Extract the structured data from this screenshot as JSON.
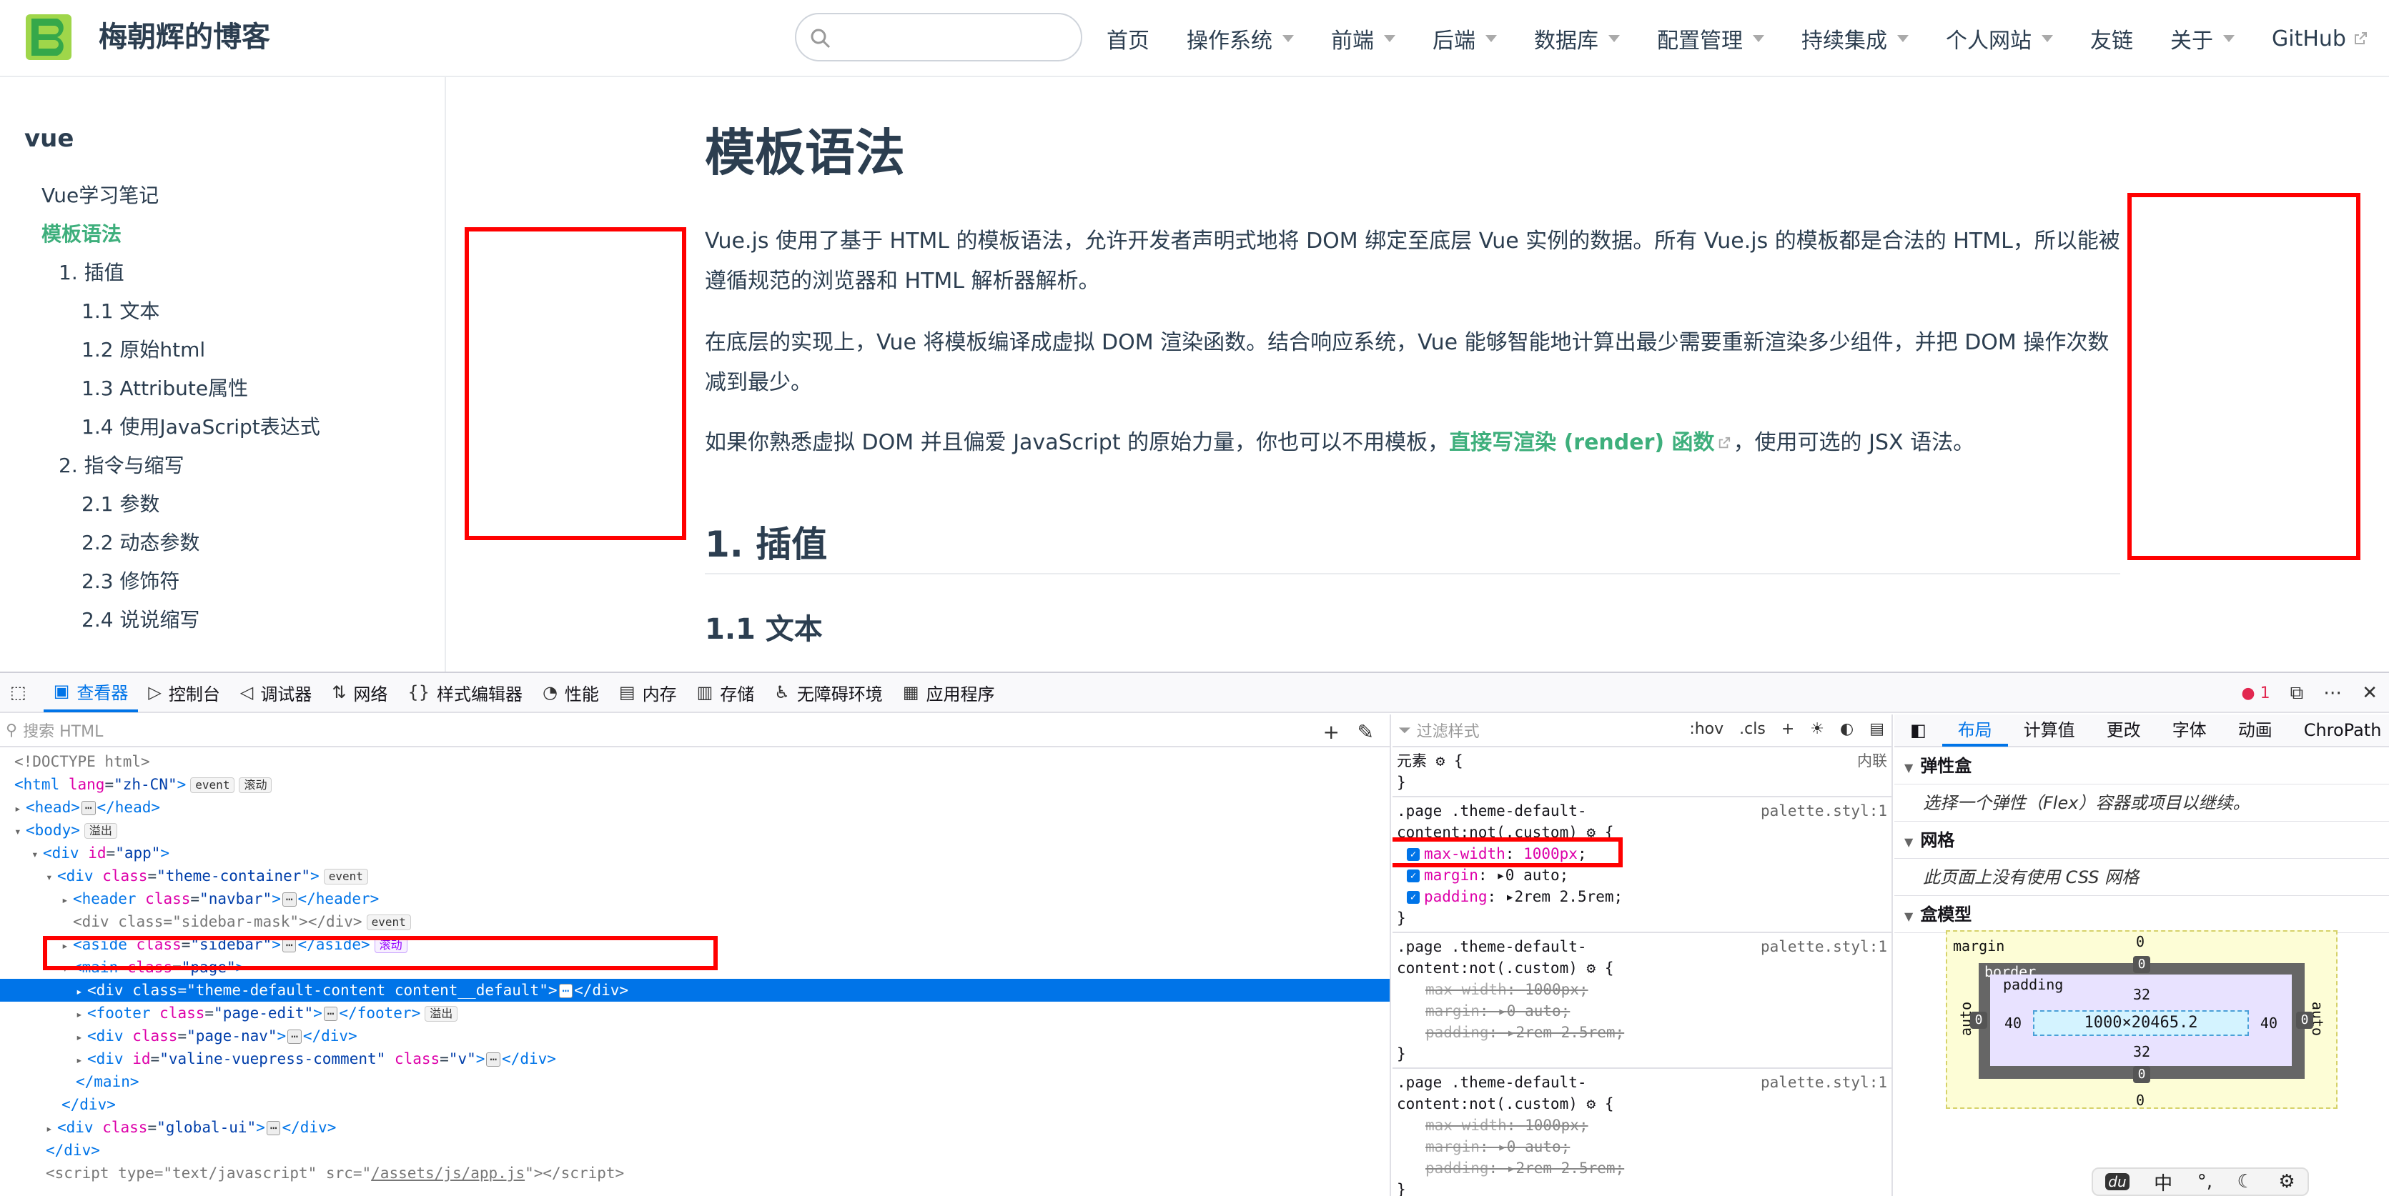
{
  "site": {
    "title": "梅朝辉的博客",
    "search_placeholder": ""
  },
  "nav": [
    {
      "label": "首页",
      "caret": false
    },
    {
      "label": "操作系统",
      "caret": true
    },
    {
      "label": "前端",
      "caret": true
    },
    {
      "label": "后端",
      "caret": true
    },
    {
      "label": "数据库",
      "caret": true
    },
    {
      "label": "配置管理",
      "caret": true
    },
    {
      "label": "持续集成",
      "caret": true
    },
    {
      "label": "个人网站",
      "caret": true
    },
    {
      "label": "友链",
      "caret": false
    },
    {
      "label": "关于",
      "caret": true
    },
    {
      "label": "GitHub",
      "caret": false,
      "external": true
    }
  ],
  "sidebar": {
    "group": "vue",
    "items": [
      {
        "label": "Vue学习笔记",
        "level": 1
      },
      {
        "label": "模板语法",
        "level": 1,
        "active": true
      },
      {
        "label": "1. 插值",
        "level": 2
      },
      {
        "label": "1.1 文本",
        "level": 3
      },
      {
        "label": "1.2 原始html",
        "level": 3
      },
      {
        "label": "1.3 Attribute属性",
        "level": 3
      },
      {
        "label": "1.4 使用JavaScript表达式",
        "level": 3
      },
      {
        "label": "2. 指令与缩写",
        "level": 2
      },
      {
        "label": "2.1 参数",
        "level": 3
      },
      {
        "label": "2.2 动态参数",
        "level": 3
      },
      {
        "label": "2.3 修饰符",
        "level": 3
      },
      {
        "label": "2.4 说说缩写",
        "level": 3
      }
    ]
  },
  "article": {
    "h1": "模板语法",
    "p1": "Vue.js 使用了基于 HTML 的模板语法，允许开发者声明式地将 DOM 绑定至底层 Vue 实例的数据。所有 Vue.js 的模板都是合法的 HTML，所以能被遵循规范的浏览器和 HTML 解析器解析。",
    "p2": "在底层的实现上，Vue 将模板编译成虚拟 DOM 渲染函数。结合响应系统，Vue 能够智能地计算出最少需要重新渲染多少组件，并把 DOM 操作次数减到最少。",
    "p3_before": "如果你熟悉虚拟 DOM 并且偏爱 JavaScript 的原始力量，你也可以不用模板，",
    "p3_link": "直接写渲染 (render) 函数",
    "p3_after": "，使用可选的 JSX 语法。",
    "h2": "1. 插值",
    "h3": "1.1 文本"
  },
  "devtools": {
    "tabs": [
      {
        "label": "查看器",
        "icon": "inspector-icon",
        "active": true
      },
      {
        "label": "控制台",
        "icon": "console-icon"
      },
      {
        "label": "调试器",
        "icon": "debugger-icon"
      },
      {
        "label": "网络",
        "icon": "network-icon"
      },
      {
        "label": "样式编辑器",
        "icon": "style-editor-icon"
      },
      {
        "label": "性能",
        "icon": "performance-icon"
      },
      {
        "label": "内存",
        "icon": "memory-icon"
      },
      {
        "label": "存储",
        "icon": "storage-icon"
      },
      {
        "label": "无障碍环境",
        "icon": "accessibility-icon"
      },
      {
        "label": "应用程序",
        "icon": "application-icon"
      }
    ],
    "error_count": "1",
    "html_search_placeholder": "搜索 HTML",
    "css_filter_placeholder": "过滤样式",
    "hov": ":hov",
    "cls": ".cls",
    "element_rule": "元素",
    "inline_label": "内联",
    "rules": [
      {
        "selector_l1": ".page .theme-default-",
        "selector_l2": "content:not(.custom)",
        "source": "palette.styl:1",
        "overridden": false,
        "props": [
          {
            "name": "max-width",
            "value": "1000px"
          },
          {
            "name": "margin",
            "value": "0 auto"
          },
          {
            "name": "padding",
            "value": "2rem 2.5rem"
          }
        ]
      },
      {
        "selector_l1": ".page .theme-default-",
        "selector_l2": "content:not(.custom)",
        "source": "palette.styl:1",
        "overridden": true,
        "props": [
          {
            "name": "max-width",
            "value": "1000px"
          },
          {
            "name": "margin",
            "value": "0 auto"
          },
          {
            "name": "padding",
            "value": "2rem 2.5rem"
          }
        ]
      },
      {
        "selector_l1": ".page .theme-default-",
        "selector_l2": "content:not(.custom)",
        "source": "palette.styl:1",
        "overridden": true,
        "props": [
          {
            "name": "max-width",
            "value": "1000px"
          },
          {
            "name": "margin",
            "value": "0 auto"
          },
          {
            "name": "padding",
            "value": "2rem 2.5rem"
          }
        ]
      }
    ],
    "layout_tabs": [
      {
        "label": "布局",
        "active": true
      },
      {
        "label": "计算值"
      },
      {
        "label": "更改"
      },
      {
        "label": "字体"
      },
      {
        "label": "动画"
      },
      {
        "label": "ChroPath"
      }
    ],
    "flex_title": "弹性盒",
    "flex_hint": "选择一个弹性（Flex）容器或项目以继续。",
    "grid_title": "网格",
    "grid_hint": "此页面上没有使用 CSS 网格",
    "boxmodel_title": "盒模型",
    "boxmodel": {
      "margin_label": "margin",
      "border_label": "border",
      "padding_label": "padding",
      "margin_top": "0",
      "margin_bottom": "0",
      "margin_left": "auto",
      "margin_right": "auto",
      "border_top": "0",
      "border_bottom": "0",
      "border_left": "0",
      "border_right": "0",
      "padding_top": "32",
      "padding_bottom": "32",
      "padding_left": "40",
      "padding_right": "40",
      "content": "1000×20465.2"
    },
    "float_toolbar": [
      "du",
      "中",
      "°,",
      "moon-icon",
      "gear-icon"
    ]
  }
}
